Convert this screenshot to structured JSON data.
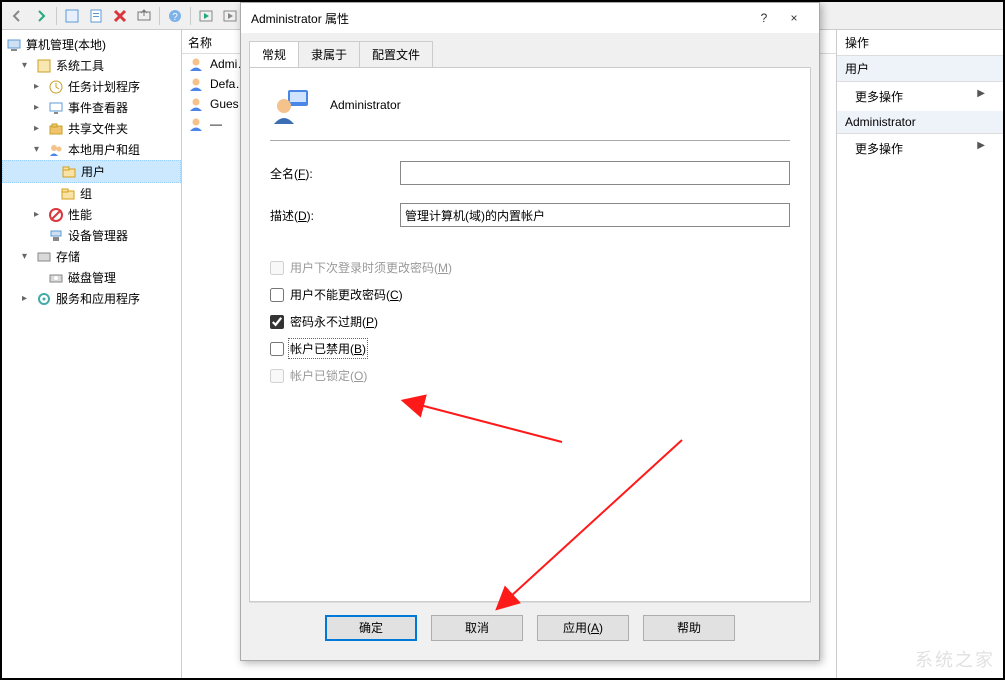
{
  "toolbar": {
    "buttons": [
      "back",
      "forward",
      "properties",
      "help",
      "delete",
      "export",
      "grid",
      "view",
      "media1",
      "media2"
    ]
  },
  "tree": {
    "root": "算机管理(本地)",
    "items": [
      {
        "label": "系统工具",
        "icon": "tools",
        "indent": 1,
        "twisty": "▾"
      },
      {
        "label": "任务计划程序",
        "icon": "clock",
        "indent": 2,
        "twisty": "▸"
      },
      {
        "label": "事件查看器",
        "icon": "monitor",
        "indent": 2,
        "twisty": "▸"
      },
      {
        "label": "共享文件夹",
        "icon": "share",
        "indent": 2,
        "twisty": "▸"
      },
      {
        "label": "本地用户和组",
        "icon": "users",
        "indent": 2,
        "twisty": "▾"
      },
      {
        "label": "用户",
        "icon": "folder",
        "indent": 3,
        "twisty": "",
        "selected": true
      },
      {
        "label": "组",
        "icon": "folder",
        "indent": 3,
        "twisty": ""
      },
      {
        "label": "性能",
        "icon": "perf",
        "indent": 2,
        "twisty": "▸"
      },
      {
        "label": "设备管理器",
        "icon": "device",
        "indent": 2,
        "twisty": ""
      },
      {
        "label": "存储",
        "icon": "storage",
        "indent": 1,
        "twisty": "▾"
      },
      {
        "label": "磁盘管理",
        "icon": "disk",
        "indent": 2,
        "twisty": ""
      },
      {
        "label": "服务和应用程序",
        "icon": "services",
        "indent": 1,
        "twisty": "▸"
      }
    ]
  },
  "list": {
    "header": "名称",
    "rows": [
      "Admi…",
      "Defa…",
      "Gues…",
      "—"
    ]
  },
  "actions": {
    "header": "操作",
    "sections": [
      {
        "title": "用户",
        "items": [
          "更多操作"
        ]
      },
      {
        "title": "Administrator",
        "items": [
          "更多操作"
        ]
      }
    ]
  },
  "dialog": {
    "title": "Administrator 属性",
    "help_tooltip": "?",
    "close_tooltip": "×",
    "tabs": [
      "常规",
      "隶属于",
      "配置文件"
    ],
    "active_tab": 0,
    "username": "Administrator",
    "fields": {
      "fullname_label_pre": "全名(",
      "fullname_hotkey": "F",
      "fullname_label_post": "):",
      "fullname_value": "",
      "desc_label_pre": "描述(",
      "desc_hotkey": "D",
      "desc_label_post": "):",
      "desc_value": "管理计算机(域)的内置帐户"
    },
    "checkboxes": [
      {
        "id": "mustchange",
        "pre": "用户下次登录时须更改密码(",
        "hk": "M",
        "post": ")",
        "checked": false,
        "disabled": true
      },
      {
        "id": "cannotchange",
        "pre": "用户不能更改密码(",
        "hk": "C",
        "post": ")",
        "checked": false,
        "disabled": false
      },
      {
        "id": "neverexp",
        "pre": "密码永不过期(",
        "hk": "P",
        "post": ")",
        "checked": true,
        "disabled": false
      },
      {
        "id": "disabled",
        "pre": "帐户已禁用(",
        "hk": "B",
        "post": ")",
        "checked": false,
        "disabled": false,
        "focus": true
      },
      {
        "id": "locked",
        "pre": "帐户已锁定(",
        "hk": "O",
        "post": ")",
        "checked": false,
        "disabled": true
      }
    ],
    "buttons": {
      "ok": "确定",
      "cancel": "取消",
      "apply_pre": "应用(",
      "apply_hk": "A",
      "apply_post": ")",
      "help": "帮助"
    }
  },
  "watermark": "系统之家"
}
